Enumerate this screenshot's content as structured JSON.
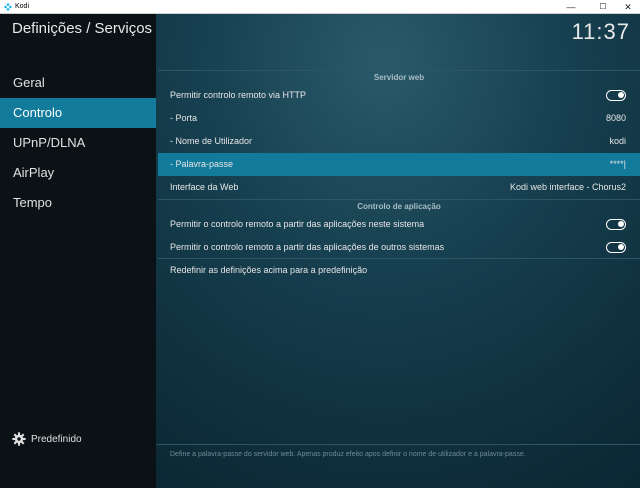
{
  "window": {
    "title": "Kodi",
    "controls": {
      "minimize": "—",
      "maximize": "☐",
      "close": "✕"
    }
  },
  "header": {
    "title": "Definições / Serviços",
    "clock": "11:37"
  },
  "sidebar": {
    "items": [
      {
        "label": "Geral",
        "active": false
      },
      {
        "label": "Controlo",
        "active": true
      },
      {
        "label": "UPnP/DLNA",
        "active": false
      },
      {
        "label": "AirPlay",
        "active": false
      },
      {
        "label": "Tempo",
        "active": false
      }
    ],
    "default_label": "Predefinido"
  },
  "sections": {
    "webserver": {
      "title": "Servidor web",
      "allow_http": {
        "label": "Permitir controlo remoto via HTTP",
        "enabled": true
      },
      "port": {
        "label": " - Porta",
        "value": "8080"
      },
      "username": {
        "label": " - Nome de Utilizador",
        "value": "kodi"
      },
      "password": {
        "label": " - Palavra-passe",
        "value": "****|"
      },
      "interface": {
        "label": "Interface da Web",
        "value": "Kodi web interface - Chorus2"
      }
    },
    "app_control": {
      "title": "Controlo de aplicação",
      "local_apps": {
        "label": "Permitir o controlo remoto a partir das aplicações neste sistema",
        "enabled": true
      },
      "other_apps": {
        "label": "Permitir o controlo remoto a partir das aplicações de outros sistemas",
        "enabled": true
      },
      "reset": {
        "label": "Redefinir as definições acima para a predefinição"
      }
    }
  },
  "footer": {
    "text": "Define a palavra-passe do servidor web. Apenas produz efeito apos definir o nome de utilizador e a palavra-passe."
  },
  "colors": {
    "accent": "#127a9a",
    "sidebar_bg": "#0b1216",
    "background": "#0e2a36"
  }
}
